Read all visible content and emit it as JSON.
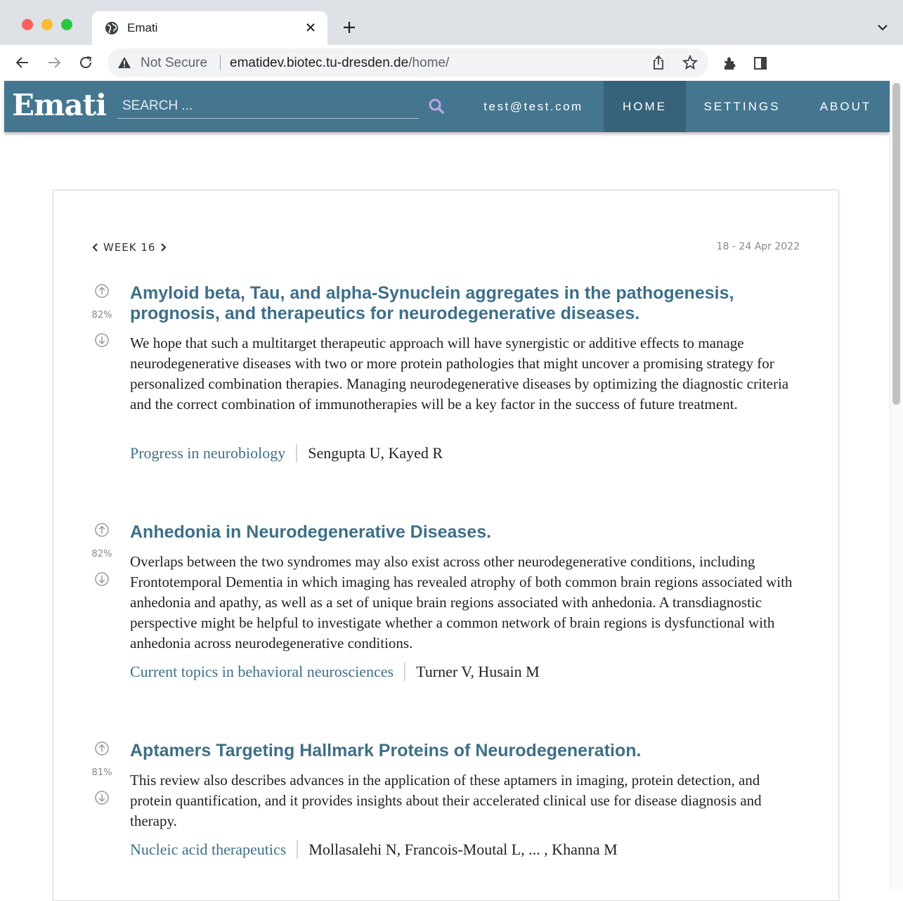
{
  "browser": {
    "tab_title": "Emati",
    "security_label": "Not Secure",
    "url_host": "ematidev.biotec.tu-dresden.de",
    "url_path": "/home/"
  },
  "header": {
    "logo": "Emati",
    "search_placeholder": "SEARCH ...",
    "user": "test@test.com",
    "nav": {
      "home": "HOME",
      "settings": "SETTINGS",
      "about": "ABOUT"
    },
    "colors": {
      "bar": "#44768f",
      "active": "#36627a"
    }
  },
  "week": {
    "label": "WEEK 16",
    "date_range": "18 - 24 Apr 2022"
  },
  "articles": [
    {
      "score": "82%",
      "title": "Amyloid beta, Tau, and alpha-Synuclein aggregates in the pathogenesis, prognosis, and therapeutics for neurodegenerative diseases.",
      "abstract": "We hope that such a multitarget therapeutic approach will have synergistic or additive effects to manage neurodegenerative diseases with two or more protein pathologies that might uncover a promising strategy for personalized combination therapies. Managing neurodegenerative diseases by optimizing the diagnostic criteria and the correct combination of immunotherapies will be a key factor in the success of future treatment.",
      "journal": "Progress in neurobiology",
      "authors": "Sengupta U, Kayed R"
    },
    {
      "score": "82%",
      "title": "Anhedonia in Neurodegenerative Diseases.",
      "abstract": "Overlaps between the two syndromes may also exist across other neurodegenerative conditions, including Frontotemporal Dementia in which imaging has revealed atrophy of both common brain regions associated with anhedonia and apathy, as well as a set of unique brain regions associated with anhedonia. A transdiagnostic perspective might be helpful to investigate whether a common network of brain regions is dysfunctional with anhedonia across neurodegenerative conditions.",
      "journal": "Current topics in behavioral neurosciences",
      "authors": "Turner V, Husain M"
    },
    {
      "score": "81%",
      "title": "Aptamers Targeting Hallmark Proteins of Neurodegeneration.",
      "abstract": "This review also describes advances in the application of these aptamers in imaging, protein detection, and protein quantification, and it provides insights about their accelerated clinical use for disease diagnosis and therapy.",
      "journal": "Nucleic acid therapeutics",
      "authors": "Mollasalehi N, Francois-Moutal L, ... , Khanna M"
    }
  ]
}
